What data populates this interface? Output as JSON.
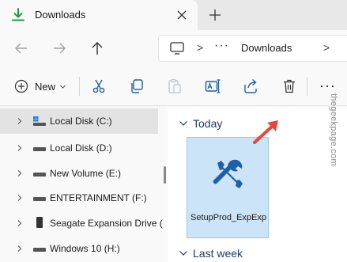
{
  "tab": {
    "title": "Downloads",
    "icon": "download-icon",
    "close_icon": "close-icon",
    "new_tab_icon": "plus-icon"
  },
  "nav": {
    "back_icon": "arrow-left-icon",
    "forward_icon": "arrow-right-icon",
    "up_icon": "arrow-up-icon",
    "address": {
      "computer_icon": "computer-icon",
      "separator": ">",
      "ellipsis": "···",
      "current": "Downloads"
    }
  },
  "commandbar": {
    "new_label": "New",
    "icons": [
      "cut-icon",
      "copy-icon",
      "paste-icon",
      "rename-icon",
      "share-icon",
      "delete-icon"
    ],
    "more": "···"
  },
  "watermark": "thegeekpage.com",
  "sidebar": {
    "items": [
      {
        "label": "Local Disk (C:)",
        "icon": "windows-drive-icon",
        "selected": true
      },
      {
        "label": "Local Disk (D:)",
        "icon": "drive-icon",
        "selected": false
      },
      {
        "label": "New Volume (E:)",
        "icon": "drive-icon",
        "selected": false
      },
      {
        "label": "ENTERTAINMENT (F:)",
        "icon": "drive-icon",
        "selected": false
      },
      {
        "label": "Seagate Expansion Drive (",
        "icon": "external-drive-icon",
        "selected": false
      },
      {
        "label": "Windows 10 (H:)",
        "icon": "drive-icon",
        "selected": false
      }
    ]
  },
  "content": {
    "groups": [
      {
        "label": "Today"
      },
      {
        "label": "Last week"
      }
    ],
    "file": {
      "name": "SetupProd_ExpExp",
      "icon": "tools-icon"
    }
  },
  "annotation": {
    "icon": "red-arrow-icon",
    "color": "#e8463c"
  },
  "colors": {
    "accent": "#0078d4",
    "selected_tile": "#cce4f7",
    "tile_border": "#99c9ef",
    "download_green": "#1b9e3e",
    "tools_blue": "#1f5fa8"
  }
}
